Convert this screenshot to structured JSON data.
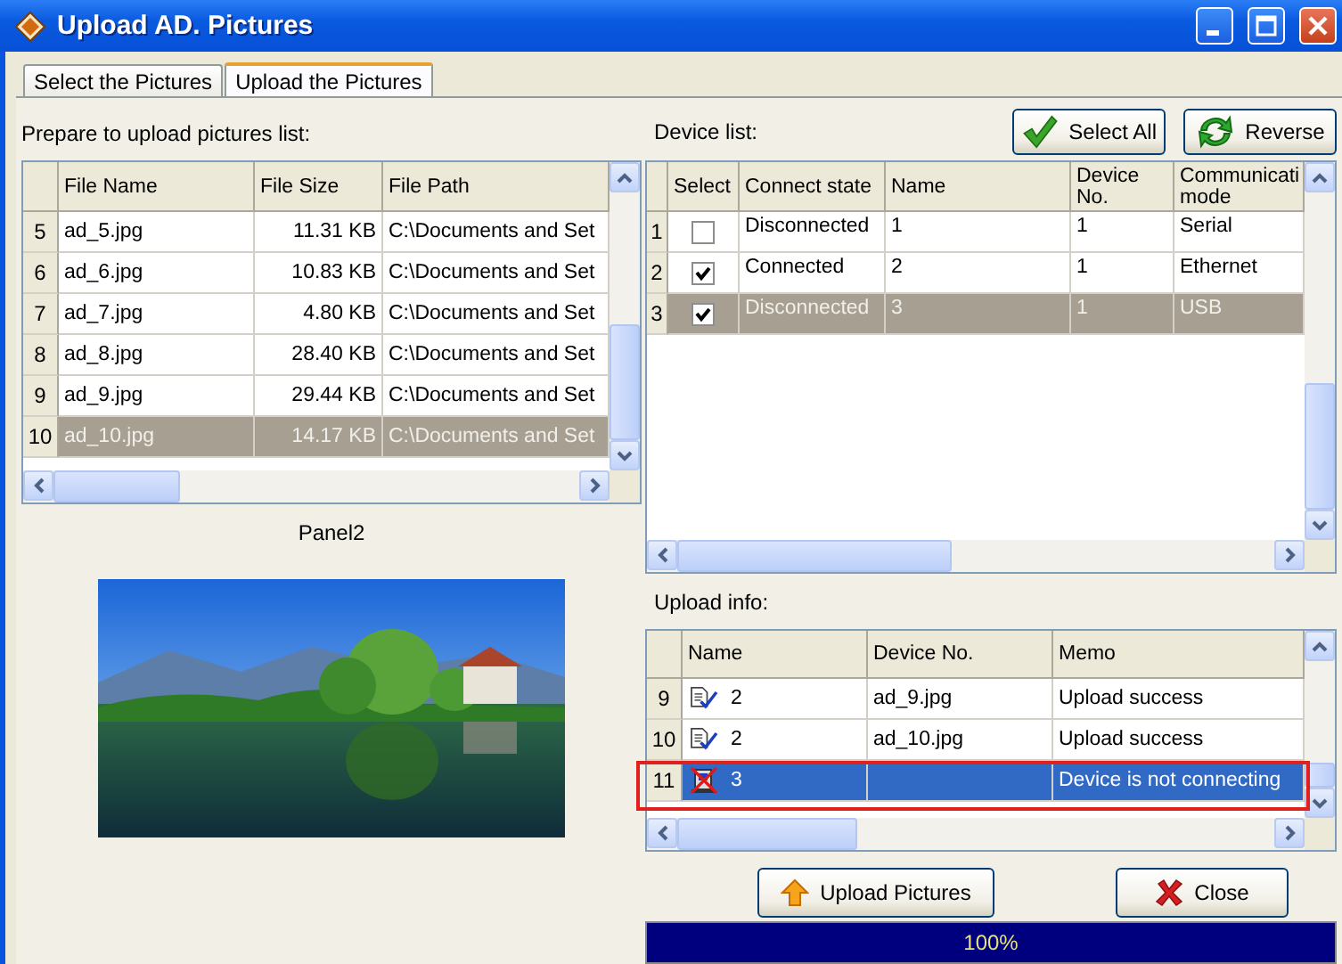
{
  "window": {
    "title": "Upload AD. Pictures"
  },
  "tabs": [
    {
      "label": "Select the Pictures",
      "selected": false
    },
    {
      "label": "Upload the Pictures",
      "selected": true
    }
  ],
  "file_list": {
    "label": "Prepare to upload pictures list:",
    "columns": [
      "File Name",
      "File Size",
      "File Path"
    ],
    "rows": [
      {
        "number": "5",
        "file_name": "ad_5.jpg",
        "file_size": "11.31 KB",
        "file_path": "C:\\Documents and Set",
        "selected": false
      },
      {
        "number": "6",
        "file_name": "ad_6.jpg",
        "file_size": "10.83 KB",
        "file_path": "C:\\Documents and Set",
        "selected": false
      },
      {
        "number": "7",
        "file_name": "ad_7.jpg",
        "file_size": "4.80 KB",
        "file_path": "C:\\Documents and Set",
        "selected": false
      },
      {
        "number": "8",
        "file_name": "ad_8.jpg",
        "file_size": "28.40 KB",
        "file_path": "C:\\Documents and Set",
        "selected": false
      },
      {
        "number": "9",
        "file_name": "ad_9.jpg",
        "file_size": "29.44 KB",
        "file_path": "C:\\Documents and Set",
        "selected": false
      },
      {
        "number": "10",
        "file_name": "ad_10.jpg",
        "file_size": "14.17 KB",
        "file_path": "C:\\Documents and Set",
        "selected": true
      }
    ]
  },
  "preview": {
    "label": "Panel2"
  },
  "devices": {
    "label": "Device list:",
    "buttons": [
      {
        "label": "Select All",
        "kind": "check"
      },
      {
        "label": "Reverse",
        "kind": "reverse"
      }
    ],
    "columns": [
      "Select",
      "Connect state",
      "Name",
      "Device No.",
      "Communicati mode"
    ],
    "rows": [
      {
        "number": "1",
        "checked": false,
        "connect_state": "Disconnected",
        "name": "1",
        "device_no": "1",
        "communication_mode": "Serial",
        "selected": false
      },
      {
        "number": "2",
        "checked": true,
        "connect_state": "Connected",
        "name": "2",
        "device_no": "1",
        "communication_mode": "Ethernet",
        "selected": false
      },
      {
        "number": "3",
        "checked": true,
        "connect_state": "Disconnected",
        "name": "3",
        "device_no": "1",
        "communication_mode": "USB",
        "selected": true
      }
    ]
  },
  "upload_info": {
    "label": "Upload info:",
    "columns": [
      "Name",
      "Device No.",
      "Memo"
    ],
    "rows": [
      {
        "number": "9",
        "kind": "success",
        "name": "2",
        "device_no": "ad_9.jpg",
        "memo": "Upload success",
        "selected": false,
        "highlighted": false
      },
      {
        "number": "10",
        "kind": "success",
        "name": "2",
        "device_no": "ad_10.jpg",
        "memo": "Upload success",
        "selected": false,
        "highlighted": false
      },
      {
        "number": "11",
        "kind": "failed",
        "name": "3",
        "device_no": "",
        "memo": "Device is not connecting",
        "selected": true,
        "highlighted": true
      }
    ]
  },
  "actions": [
    {
      "label": "Upload Pictures",
      "kind": "upload"
    },
    {
      "label": "Close",
      "kind": "close"
    }
  ],
  "progress": {
    "level": 1,
    "text": "100%"
  }
}
